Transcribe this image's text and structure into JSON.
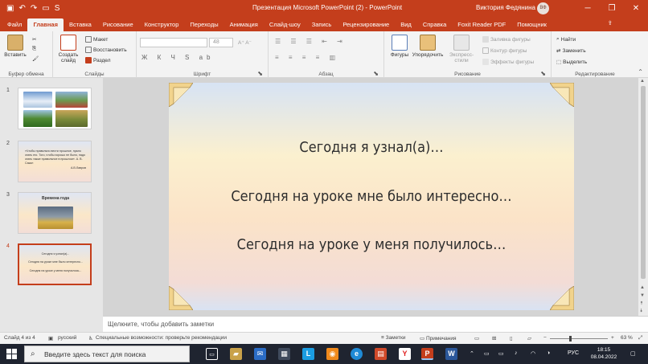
{
  "window": {
    "title": "Презентация Microsoft PowerPoint (2)  -  PowerPoint",
    "user": "Виктория Федянина",
    "user_initials": "ВФ",
    "qat_s": "S"
  },
  "tabs": [
    "Файл",
    "Главная",
    "Вставка",
    "Рисование",
    "Конструктор",
    "Переходы",
    "Анимация",
    "Слайд-шоу",
    "Запись",
    "Рецензирование",
    "Вид",
    "Справка",
    "Foxit Reader PDF"
  ],
  "active_tab": "Главная",
  "help_search": "Помощник",
  "ribbon": {
    "clipboard": {
      "paste": "Вставить",
      "label": "Буфер обмена"
    },
    "slides": {
      "new_slide": "Создать слайд",
      "layout": "Макет",
      "reset": "Восстановить",
      "section": "Раздел",
      "label": "Слайды"
    },
    "font": {
      "label": "Шрифт",
      "size": "48",
      "format_row": "Ж К Ч S ab"
    },
    "paragraph": {
      "label": "Абзац"
    },
    "drawing": {
      "shapes": "Фигуры",
      "arrange": "Упорядочить",
      "quick_styles": "Экспресс-стили",
      "fill": "Заливка фигуры",
      "outline": "Контур фигуры",
      "effects": "Эффекты фигуры",
      "label": "Рисование"
    },
    "editing": {
      "find": "Найти",
      "replace": "Заменить",
      "select": "Выделить",
      "label": "Редактирование"
    }
  },
  "thumbnails": [
    {
      "num": "1"
    },
    {
      "num": "2",
      "text": "«Чтобы правильно вести прошлое, нужно знать его. Того, чтобы хорошо не было, надо знать также правильное в прошлом». А. В. Сакал",
      "author": "А.В.Лавров"
    },
    {
      "num": "3",
      "title": "Времена года"
    },
    {
      "num": "4",
      "lines": [
        "Сегодня я узнал(а)...",
        "Сегодня на уроке мне было интересно...",
        "Сегодня на уроке у меня получилось..."
      ]
    }
  ],
  "slide": {
    "lines": [
      "Сегодня я узнал(а)…",
      "Сегодня на уроке мне было интересно…",
      "Сегодня на уроке у меня получилось…"
    ]
  },
  "notes_placeholder": "Щелкните, чтобы добавить заметки",
  "status": {
    "slide_counter": "Слайд 4 из 4",
    "language": "русский",
    "accessibility": "Специальные возможности: проверьте рекомендации",
    "notes": "Заметки",
    "comments": "Примечания",
    "zoom": "63 %"
  },
  "taskbar": {
    "search_placeholder": "Введите здесь текст для поиска",
    "lang": "РУС",
    "time": "18:15",
    "date": "08.04.2022"
  },
  "colors": {
    "accent": "#c43e1c",
    "taskbar": "#1f2430"
  }
}
